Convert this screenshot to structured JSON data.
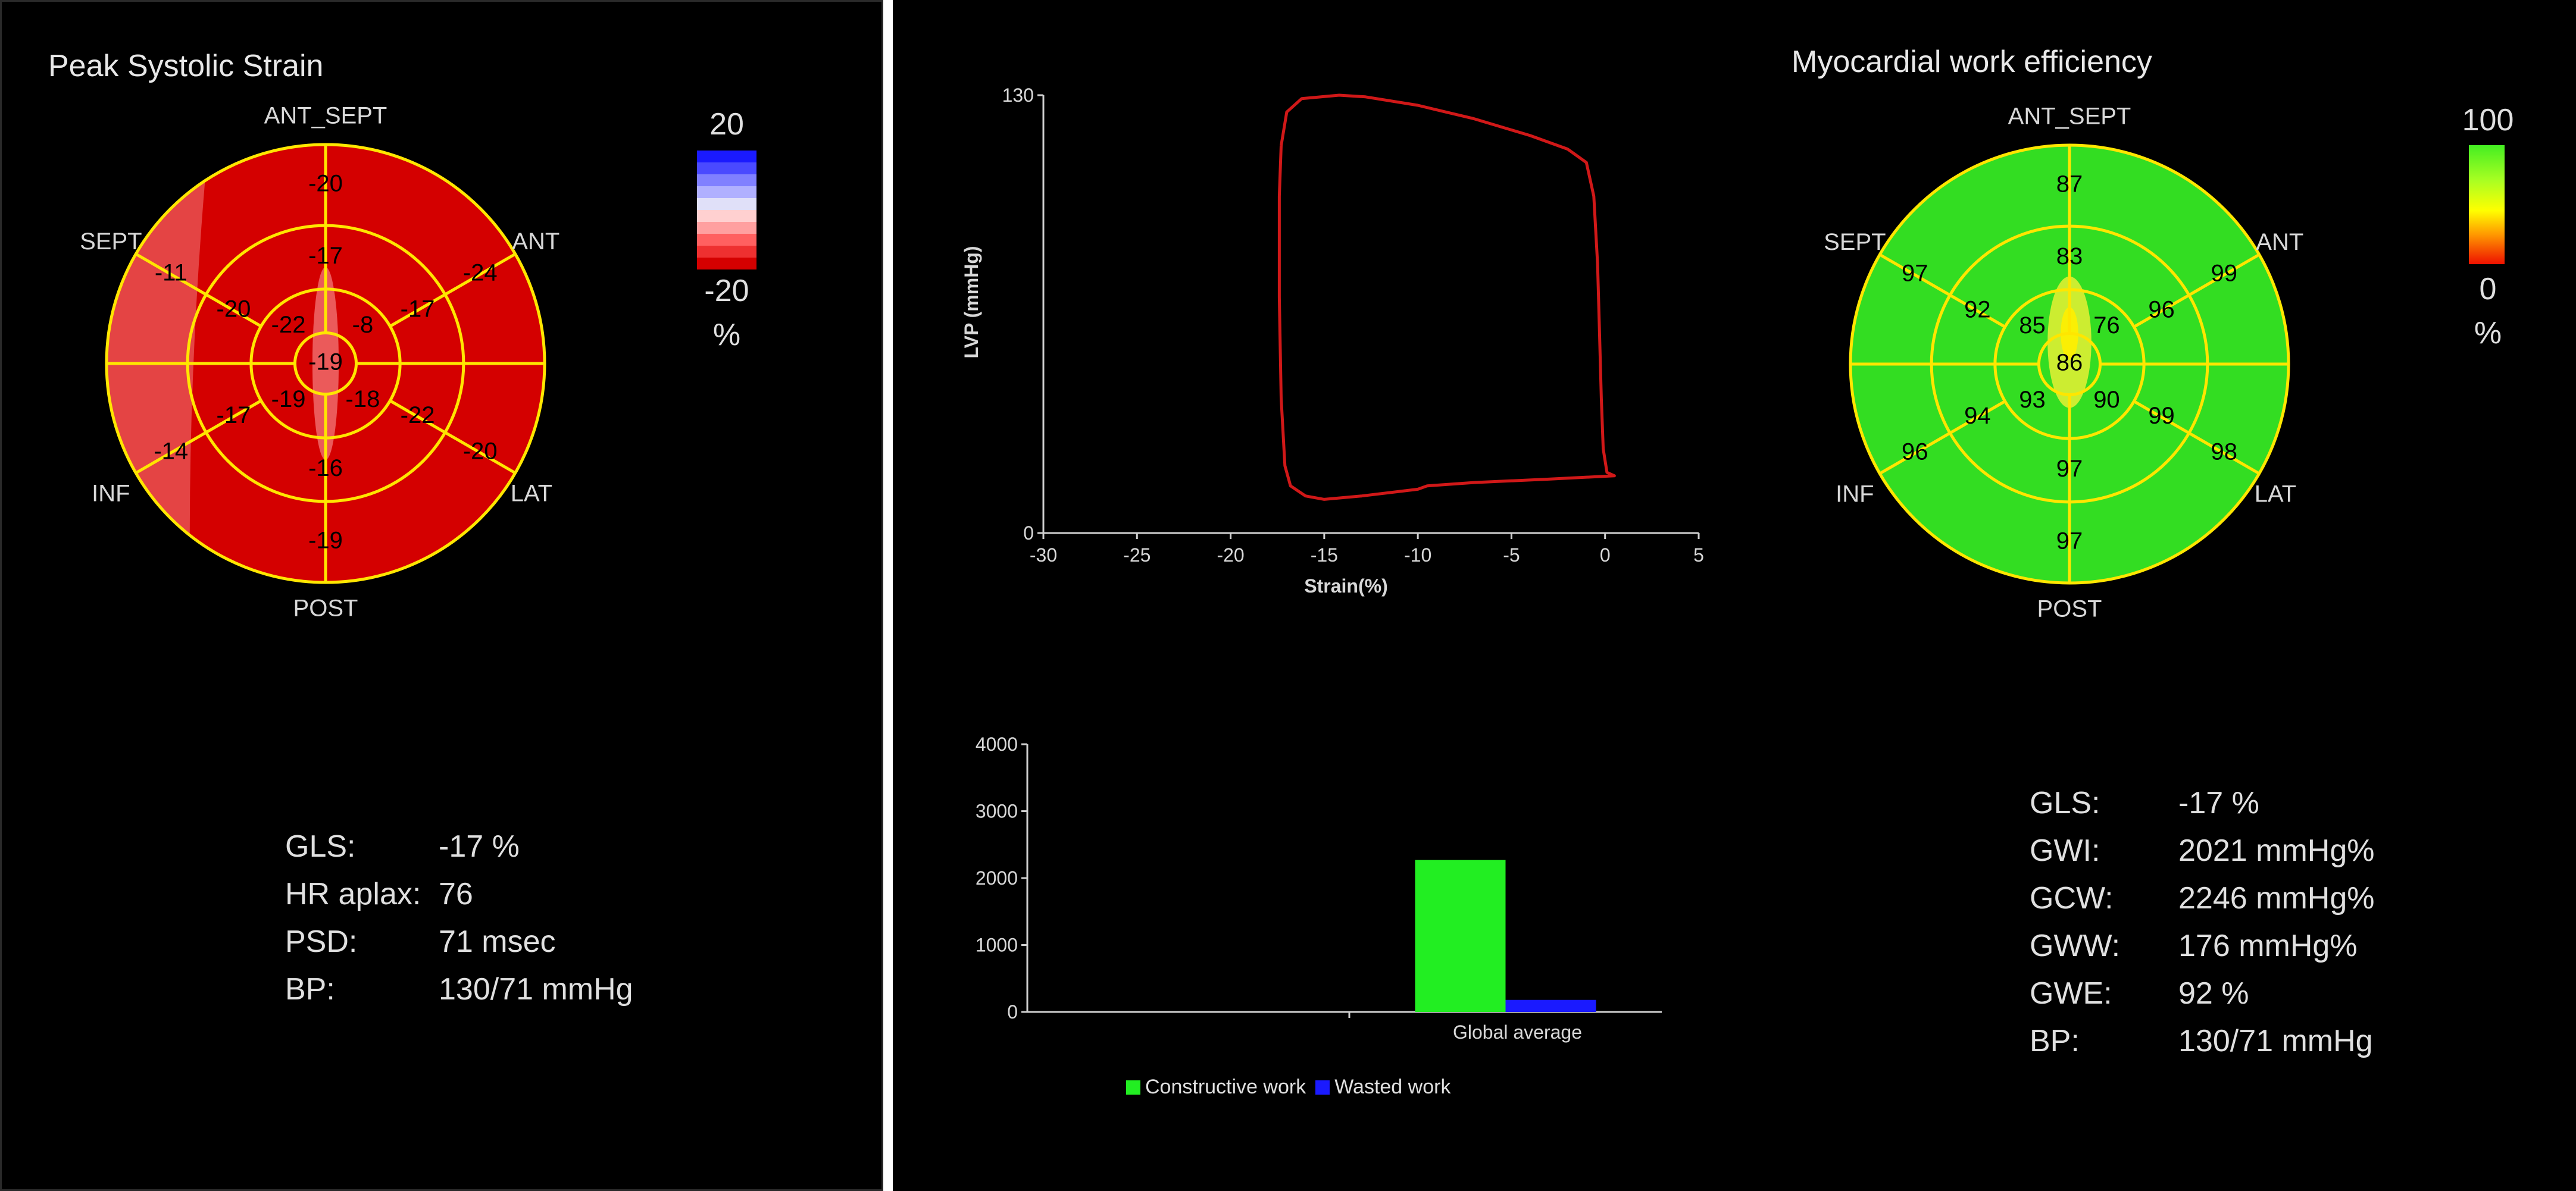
{
  "left": {
    "title": "Peak Systolic Strain",
    "wall_labels": {
      "ant_sept": "ANT_SEPT",
      "ant": "ANT",
      "lat": "LAT",
      "post": "POST",
      "inf": "INF",
      "sept": "SEPT"
    },
    "bullseye_values": {
      "outer": {
        "ant_sept": "-20",
        "ant": "-24",
        "lat": "-20",
        "post": "-19",
        "inf": "-14",
        "sept": "-11"
      },
      "middle": {
        "ant_sept": "-17",
        "ant": "-17",
        "lat": "-22",
        "post": "-16",
        "inf": "-17",
        "sept": "-20"
      },
      "inner": {
        "ant_sept": "-22",
        "ant": "-8",
        "post": "-18",
        "inf": "-19"
      },
      "apex": "-19"
    },
    "color_scale": {
      "max": "20",
      "min": "-20",
      "unit": "%"
    },
    "stats": [
      {
        "key": "GLS:",
        "value": "-17 %"
      },
      {
        "key": "HR aplax:",
        "value": "76"
      },
      {
        "key": "PSD:",
        "value": "71 msec"
      },
      {
        "key": "BP:",
        "value": "130/71 mmHg"
      }
    ]
  },
  "right": {
    "title": "Myocardial work efficiency",
    "wall_labels": {
      "ant_sept": "ANT_SEPT",
      "ant": "ANT",
      "lat": "LAT",
      "post": "POST",
      "inf": "INF",
      "sept": "SEPT"
    },
    "bullseye_values": {
      "outer": {
        "ant_sept": "87",
        "ant": "99",
        "lat": "98",
        "post": "97",
        "inf": "96",
        "sept": "97"
      },
      "middle": {
        "ant_sept": "83",
        "ant": "96",
        "lat": "99",
        "post": "97",
        "inf": "94",
        "sept": "92"
      },
      "inner": {
        "ant_sept": "85",
        "ant": "76",
        "post": "90",
        "inf": "93"
      },
      "apex": "86"
    },
    "color_scale": {
      "max": "100",
      "min": "0",
      "unit": "%"
    },
    "stats": [
      {
        "key": "GLS:",
        "value": "-17 %"
      },
      {
        "key": "GWI:",
        "value": "2021 mmHg%"
      },
      {
        "key": "GCW:",
        "value": "2246 mmHg%"
      },
      {
        "key": "GWW:",
        "value": "176 mmHg%"
      },
      {
        "key": "GWE:",
        "value": "92 %"
      },
      {
        "key": "BP:",
        "value": "130/71 mmHg"
      }
    ]
  },
  "colors": {
    "strain_red": "#d40000",
    "efficiency_green": "#33dd22",
    "bullseye_lines": "#ffe600",
    "loop_line": "#d01818",
    "constructive": "#22ee22",
    "wasted": "#1a1aff"
  },
  "chart_data": [
    {
      "type": "line",
      "title": "",
      "xlabel": "Strain(%)",
      "ylabel": "LVP (mmHg)",
      "xlim": [
        -30,
        5
      ],
      "ylim": [
        0,
        130
      ],
      "x_ticks": [
        "-30",
        "-25",
        "-20",
        "-15",
        "-10",
        "-5",
        "0",
        "5"
      ],
      "y_ticks": [
        "0",
        "130"
      ],
      "series": [
        {
          "points": [
            [
              -17.3,
              115
            ],
            [
              -17.0,
              125
            ],
            [
              -16.2,
              129
            ],
            [
              -14.2,
              130
            ],
            [
              -12.8,
              129.5
            ],
            [
              -10.0,
              127
            ],
            [
              -7.0,
              123
            ],
            [
              -4.0,
              118
            ],
            [
              -2.0,
              114
            ],
            [
              -1.0,
              110
            ],
            [
              -0.6,
              100
            ],
            [
              -0.4,
              80
            ],
            [
              -0.3,
              60
            ],
            [
              -0.2,
              40
            ],
            [
              -0.1,
              25
            ],
            [
              0.1,
              18
            ],
            [
              0.5,
              17
            ],
            [
              -3.0,
              16
            ],
            [
              -7.0,
              15
            ],
            [
              -9.5,
              14
            ],
            [
              -10.0,
              13
            ],
            [
              -13.0,
              11
            ],
            [
              -15.0,
              10
            ],
            [
              -16.0,
              11
            ],
            [
              -16.8,
              14
            ],
            [
              -17.1,
              20
            ],
            [
              -17.3,
              40
            ],
            [
              -17.4,
              70
            ],
            [
              -17.4,
              100
            ],
            [
              -17.3,
              115
            ]
          ]
        }
      ]
    },
    {
      "type": "bar",
      "title": "",
      "categories": [
        "",
        "Global average"
      ],
      "ylim": [
        0,
        4000
      ],
      "y_ticks": [
        "0",
        "1000",
        "2000",
        "3000",
        "4000"
      ],
      "series": [
        {
          "name": "Constructive work",
          "values": [
            0,
            2270
          ]
        },
        {
          "name": "Wasted work",
          "values": [
            0,
            180
          ]
        }
      ],
      "legend": "bottom"
    }
  ]
}
